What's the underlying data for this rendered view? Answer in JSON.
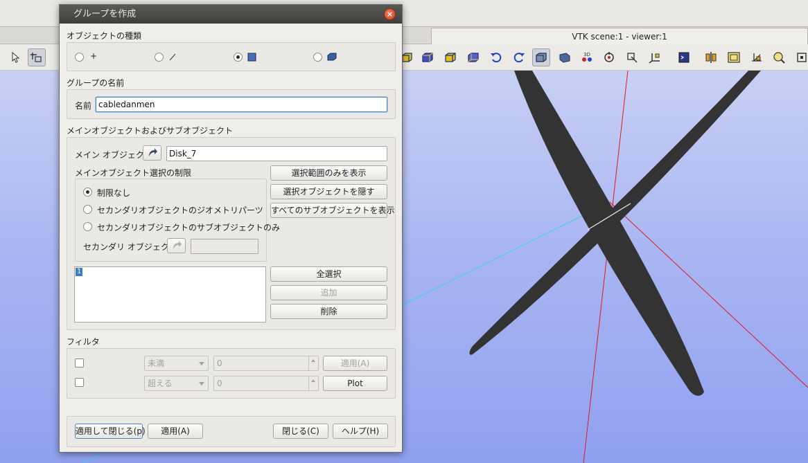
{
  "viewer": {
    "tab_title": "VTK scene:1 - viewer:1"
  },
  "toolbar": {
    "icons": [
      "select-icon",
      "point-select-icon",
      "front-view-icon",
      "back-view-icon",
      "top-view-icon",
      "bottom-view-icon",
      "left-view-icon",
      "rotate-left-icon",
      "rotate-right-icon",
      "shading-icon",
      "solid-icon",
      "anaglyph-3d-icon",
      "rotation-point-icon",
      "scale-icon",
      "trihedron-icon",
      "script-icon",
      "clipping-icon",
      "dump-view-icon",
      "projection-icon",
      "interaction-style-icon",
      "more-icon"
    ]
  },
  "dialog": {
    "title": "グループを作成",
    "close_label": "×",
    "object_type": {
      "title": "オブジェクトの種類",
      "options": [
        {
          "name": "point",
          "glyph": "+",
          "selected": false
        },
        {
          "name": "edge",
          "glyph": "/",
          "selected": false
        },
        {
          "name": "face",
          "glyph": "square",
          "selected": true
        },
        {
          "name": "solid",
          "glyph": "cube",
          "selected": false
        }
      ]
    },
    "group_name": {
      "title": "グループの名前",
      "label": "名前",
      "value": "cabledanmen"
    },
    "main_sub": {
      "title": "メインオブジェクトおよびサブオブジェクト",
      "main_object_label": "メイン オブジェクト",
      "main_object_value": "Disk_7",
      "restriction_title": "メインオブジェクト選択の制限",
      "restriction_options": [
        {
          "label": "制限なし",
          "selected": true
        },
        {
          "label": "セカンダリオブジェクトのジオメトリパーツ",
          "selected": false
        },
        {
          "label": "セカンダリオブジェクトのサブオブジェクトのみ",
          "selected": false
        }
      ],
      "secondary_object_label": "セカンダリ オブジェクト",
      "secondary_object_value": "",
      "show_only_selected": "選択範囲のみを表示",
      "hide_selected": "選択オブジェクトを隠す",
      "show_all_sub": "すべてのサブオブジェクトを表示",
      "list_items": [
        "1"
      ],
      "select_all": "全選択",
      "add": "追加",
      "remove": "削除"
    },
    "filter": {
      "title": "フィルタ",
      "rows": [
        {
          "checked": false,
          "combo": "未満",
          "value": "0",
          "button": "適用(A)",
          "button_enabled": false
        },
        {
          "checked": false,
          "combo": "超える",
          "value": "0",
          "button": "Plot",
          "button_enabled": true
        }
      ]
    },
    "footer": {
      "apply_close": "適用して閉じる(p)",
      "apply": "適用(A)",
      "close": "閉じる(C)",
      "help": "ヘルプ(H)"
    }
  }
}
